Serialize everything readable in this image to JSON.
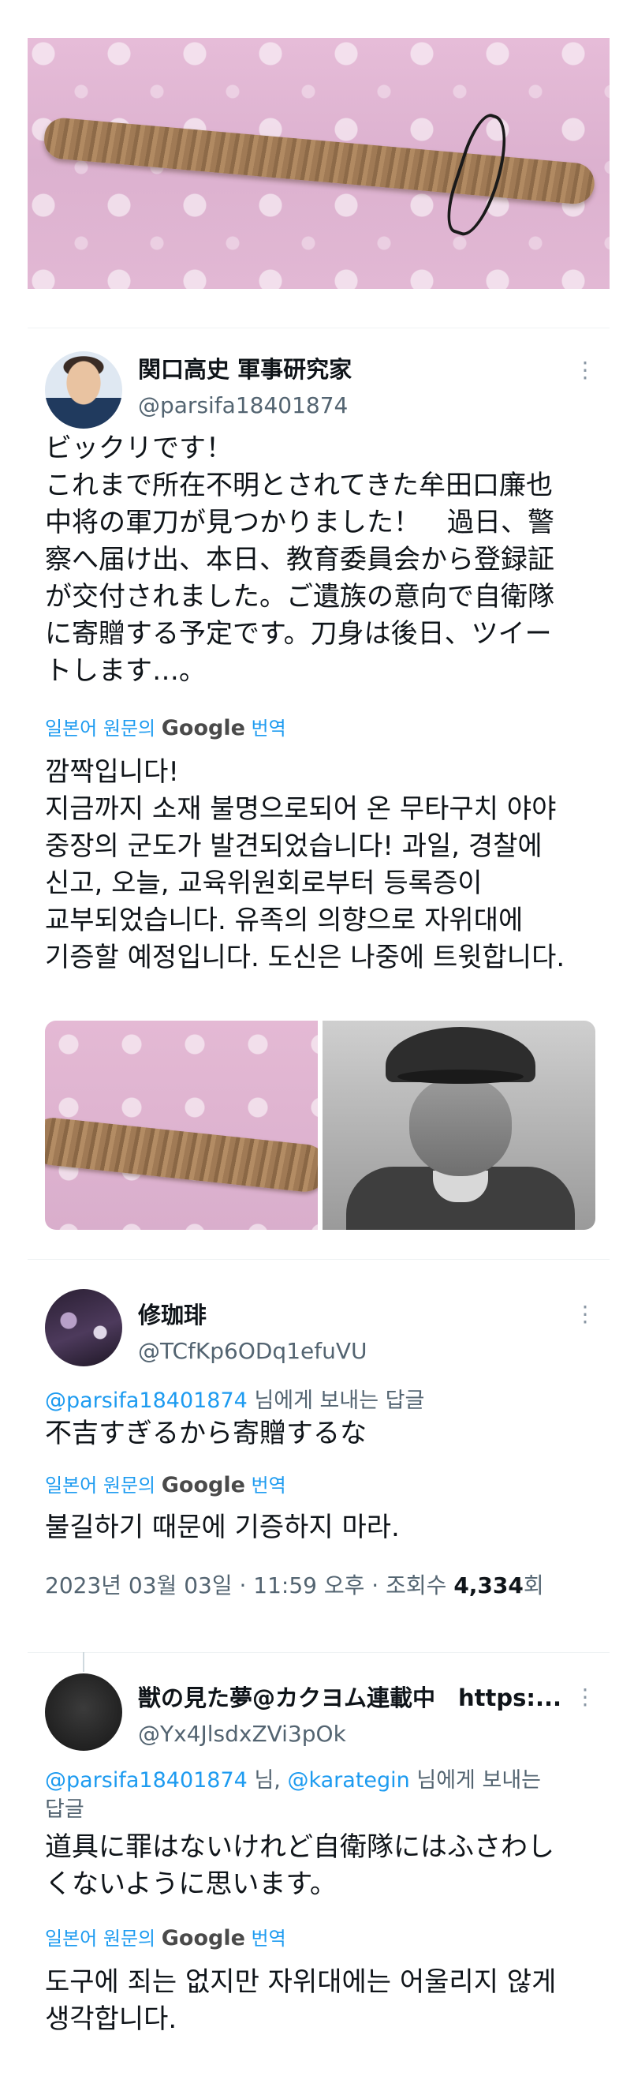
{
  "tweet1": {
    "name": "関口高史 軍事研究家",
    "handle": "@parsifa18401874",
    "body_lines": [
      "ビックリです！",
      "これまで所在不明とされてきた牟田口廉也",
      "中将の軍刀が見つかりました！　過日、警",
      "察へ届け出、本日、教育委員会から登録証",
      "が交付されました。ご遺族の意向で自衛隊",
      "に寄贈する予定です。刀身は後日、ツイー",
      "トします…。"
    ],
    "translate_prefix": "일본어 원문의",
    "translate_brand": "Google",
    "translate_suffix": "번역",
    "translation_lines": [
      "깜짝입니다!",
      "지금까지 소재 불명으로되어 온 무타구치 야야",
      "중장의 군도가 발견되었습니다! 과일, 경찰에",
      "신고, 오늘, 교육위원회로부터 등록증이",
      "교부되었습니다. 유족의 의향으로 자위대에",
      "기증할 예정입니다. 도신은 나중에 트윗합니다."
    ]
  },
  "tweet2": {
    "name": "修珈琲",
    "handle": "@TCfKp6ODq1efuVU",
    "reply_mention": "@parsifa18401874",
    "reply_suffix": "님에게 보내는 답글",
    "body": "不吉すぎるから寄贈するな",
    "translate_prefix": "일본어 원문의",
    "translate_brand": "Google",
    "translate_suffix": "번역",
    "translation": "불길하기 때문에 기증하지 마라.",
    "timestamp": "2023년 03월 03일 · 11:59 오후 · 조회수",
    "views": "4,334",
    "views_suffix": "회"
  },
  "tweet3": {
    "name": "獣の見た夢@カクヨム連載中　https:...",
    "handle": "@Yx4JlsdxZVi3pOk",
    "reply_mention_1": "@parsifa18401874",
    "reply_sep": "님,",
    "reply_mention_2": "@karategin",
    "reply_suffix_1": "님에게 보내는",
    "reply_suffix_2": "답글",
    "body_lines": [
      "道具に罪はないけれど自衛隊にはふさわし",
      "くないように思います。"
    ],
    "translate_prefix": "일본어 원문의",
    "translate_brand": "Google",
    "translate_suffix": "번역",
    "translation_lines": [
      "도구에 죄는 없지만 자위대에는 어울리지 않게",
      "생각합니다."
    ]
  },
  "icons": {
    "more": "more-options-icon"
  },
  "colors": {
    "link": "#1d9bf0",
    "secondary_text": "#536471",
    "primary_text": "#0f1419"
  }
}
